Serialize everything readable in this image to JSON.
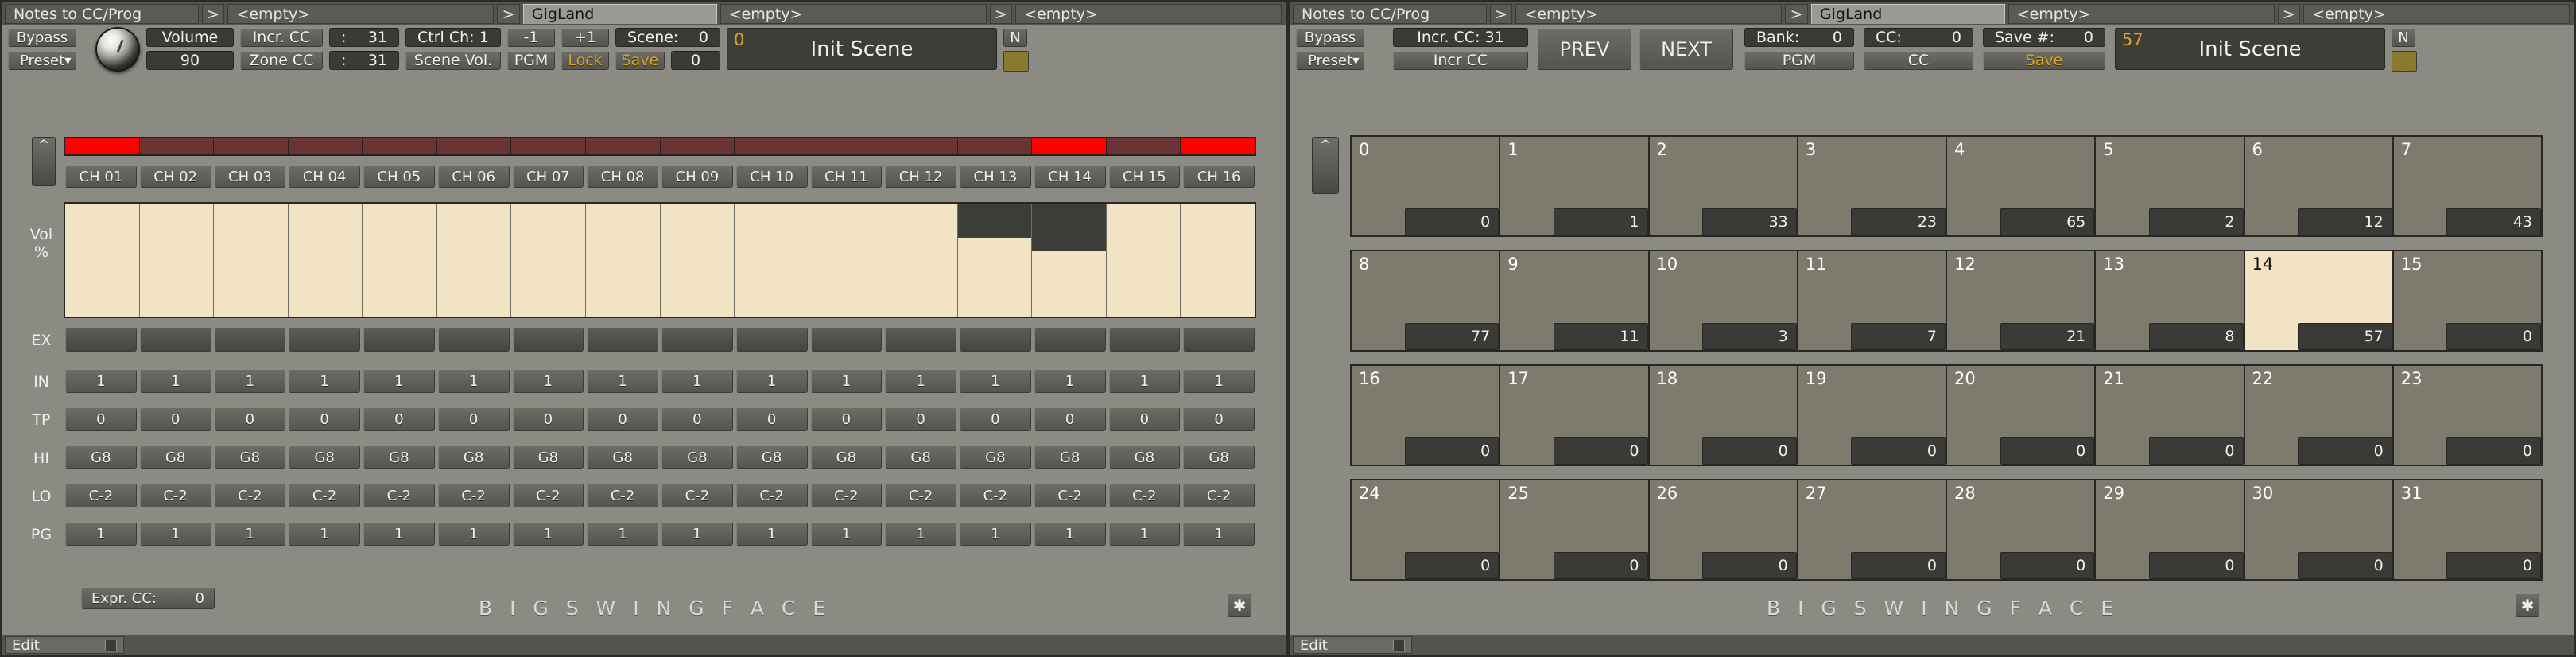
{
  "left": {
    "tabs": [
      {
        "label": "Notes to CC/Prog",
        "type": "wide1"
      },
      {
        "label": ">",
        "type": "arrow"
      },
      {
        "label": "<empty>",
        "type": "wide2"
      },
      {
        "label": ">",
        "type": "arrow"
      },
      {
        "label": "GigLand",
        "type": "active"
      },
      {
        "label": "<empty>",
        "type": "wide2"
      },
      {
        "label": ">",
        "type": "arrow"
      },
      {
        "label": "<empty>",
        "type": "wide2"
      }
    ],
    "bypass_label": "Bypass",
    "preset_label": "Preset",
    "preset_arrow": "▼",
    "knob_name": "volume-knob",
    "volume_label": "Volume",
    "volume_value": "90",
    "incr_cc_label": "Incr. CC",
    "incr_cc_sep": ":",
    "incr_cc_value": "31",
    "zone_cc_label": "Zone CC",
    "zone_cc_sep": ":",
    "zone_cc_value": "31",
    "ctrl_ch_label": "Ctrl Ch:",
    "ctrl_ch_value": "1",
    "scene_vol_label": "Scene Vol.",
    "minus_label": "-1",
    "plus_label": "+1",
    "pgm_label": "PGM",
    "lock_label": "Lock",
    "scene_label": "Scene:",
    "scene_value": "0",
    "save_label": "Save",
    "save_value": "0",
    "display_number": "0",
    "display_name": "Init Scene",
    "n_badge": "N",
    "scroll_up": "^",
    "leds": [
      1,
      0,
      0,
      0,
      0,
      0,
      0,
      0,
      0,
      0,
      0,
      0,
      0,
      1,
      0,
      1
    ],
    "channels": [
      "CH 01",
      "CH 02",
      "CH 03",
      "CH 04",
      "CH 05",
      "CH 06",
      "CH 07",
      "CH 08",
      "CH 09",
      "CH 10",
      "CH 11",
      "CH 12",
      "CH 13",
      "CH 14",
      "CH 15",
      "CH 16"
    ],
    "vol_row_label": "Vol\n%",
    "vol_label_line1": "Vol",
    "vol_label_line2": "%",
    "vol_values": [
      100,
      100,
      100,
      100,
      100,
      100,
      100,
      100,
      100,
      100,
      100,
      100,
      70,
      58,
      100,
      100
    ],
    "rows": [
      {
        "name": "EX",
        "values": [
          "",
          "",
          "",
          "",
          "",
          "",
          "",
          "",
          "",
          "",
          "",
          "",
          "",
          "",
          "",
          ""
        ]
      },
      {
        "name": "IN",
        "values": [
          "1",
          "1",
          "1",
          "1",
          "1",
          "1",
          "1",
          "1",
          "1",
          "1",
          "1",
          "1",
          "1",
          "1",
          "1",
          "1"
        ]
      },
      {
        "name": "TP",
        "values": [
          "0",
          "0",
          "0",
          "0",
          "0",
          "0",
          "0",
          "0",
          "0",
          "0",
          "0",
          "0",
          "0",
          "0",
          "0",
          "0"
        ]
      },
      {
        "name": "HI",
        "values": [
          "G8",
          "G8",
          "G8",
          "G8",
          "G8",
          "G8",
          "G8",
          "G8",
          "G8",
          "G8",
          "G8",
          "G8",
          "G8",
          "G8",
          "G8",
          "G8"
        ]
      },
      {
        "name": "LO",
        "values": [
          "C-2",
          "C-2",
          "C-2",
          "C-2",
          "C-2",
          "C-2",
          "C-2",
          "C-2",
          "C-2",
          "C-2",
          "C-2",
          "C-2",
          "C-2",
          "C-2",
          "C-2",
          "C-2"
        ]
      },
      {
        "name": "PG",
        "values": [
          "1",
          "1",
          "1",
          "1",
          "1",
          "1",
          "1",
          "1",
          "1",
          "1",
          "1",
          "1",
          "1",
          "1",
          "1",
          "1"
        ]
      }
    ],
    "expr_cc_label": "Expr. CC:",
    "expr_cc_value": "0",
    "brand": "B I G   S W I N G   F A C E",
    "star": "✱",
    "status_edit": "Edit"
  },
  "right": {
    "tabs": [
      {
        "label": "Notes to CC/Prog",
        "type": "wide1"
      },
      {
        "label": ">",
        "type": "arrow"
      },
      {
        "label": "<empty>",
        "type": "wide2"
      },
      {
        "label": ">",
        "type": "arrow"
      },
      {
        "label": "GigLand",
        "type": "active"
      },
      {
        "label": "<empty>",
        "type": "wide2"
      },
      {
        "label": ">",
        "type": "arrow"
      },
      {
        "label": "<empty>",
        "type": "wide2"
      }
    ],
    "bypass_label": "Bypass",
    "preset_label": "Preset",
    "preset_arrow": "▼",
    "incr_cc_label": "Incr. CC:  31",
    "incr_cc_btn": "Incr CC",
    "prev_label": "PREV",
    "next_label": "NEXT",
    "bank_label": "Bank:",
    "bank_value": "0",
    "pgm_label": "PGM",
    "cc_label": "CC:",
    "cc_value": "0",
    "cc_btn": "CC",
    "save_num_label": "Save #:",
    "save_num_value": "0",
    "save_label": "Save",
    "display_number": "57",
    "display_name": "Init Scene",
    "n_badge": "N",
    "scroll_up": "^",
    "pads": [
      [
        {
          "idx": "0",
          "val": "0"
        },
        {
          "idx": "1",
          "val": "1"
        },
        {
          "idx": "2",
          "val": "33"
        },
        {
          "idx": "3",
          "val": "23"
        },
        {
          "idx": "4",
          "val": "65"
        },
        {
          "idx": "5",
          "val": "2"
        },
        {
          "idx": "6",
          "val": "12"
        },
        {
          "idx": "7",
          "val": "43"
        }
      ],
      [
        {
          "idx": "8",
          "val": "77"
        },
        {
          "idx": "9",
          "val": "11"
        },
        {
          "idx": "10",
          "val": "3"
        },
        {
          "idx": "11",
          "val": "7"
        },
        {
          "idx": "12",
          "val": "21"
        },
        {
          "idx": "13",
          "val": "8"
        },
        {
          "idx": "14",
          "val": "57",
          "selected": true
        },
        {
          "idx": "15",
          "val": "0"
        }
      ],
      [
        {
          "idx": "16",
          "val": "0"
        },
        {
          "idx": "17",
          "val": "0"
        },
        {
          "idx": "18",
          "val": "0"
        },
        {
          "idx": "19",
          "val": "0"
        },
        {
          "idx": "20",
          "val": "0"
        },
        {
          "idx": "21",
          "val": "0"
        },
        {
          "idx": "22",
          "val": "0"
        },
        {
          "idx": "23",
          "val": "0"
        }
      ],
      [
        {
          "idx": "24",
          "val": "0"
        },
        {
          "idx": "25",
          "val": "0"
        },
        {
          "idx": "26",
          "val": "0"
        },
        {
          "idx": "27",
          "val": "0"
        },
        {
          "idx": "28",
          "val": "0"
        },
        {
          "idx": "29",
          "val": "0"
        },
        {
          "idx": "30",
          "val": "0"
        },
        {
          "idx": "31",
          "val": "0"
        }
      ]
    ],
    "brand": "B I G   S W I N G   F A C E",
    "star": "✱",
    "status_edit": "Edit"
  },
  "colors": {
    "panel": "#8b8b84",
    "led_on": "#ff0000",
    "led_off": "#6b3333",
    "amber": "#d9a521",
    "pad": "#7e7a6e",
    "pad_selected": "#f2e3c4"
  }
}
